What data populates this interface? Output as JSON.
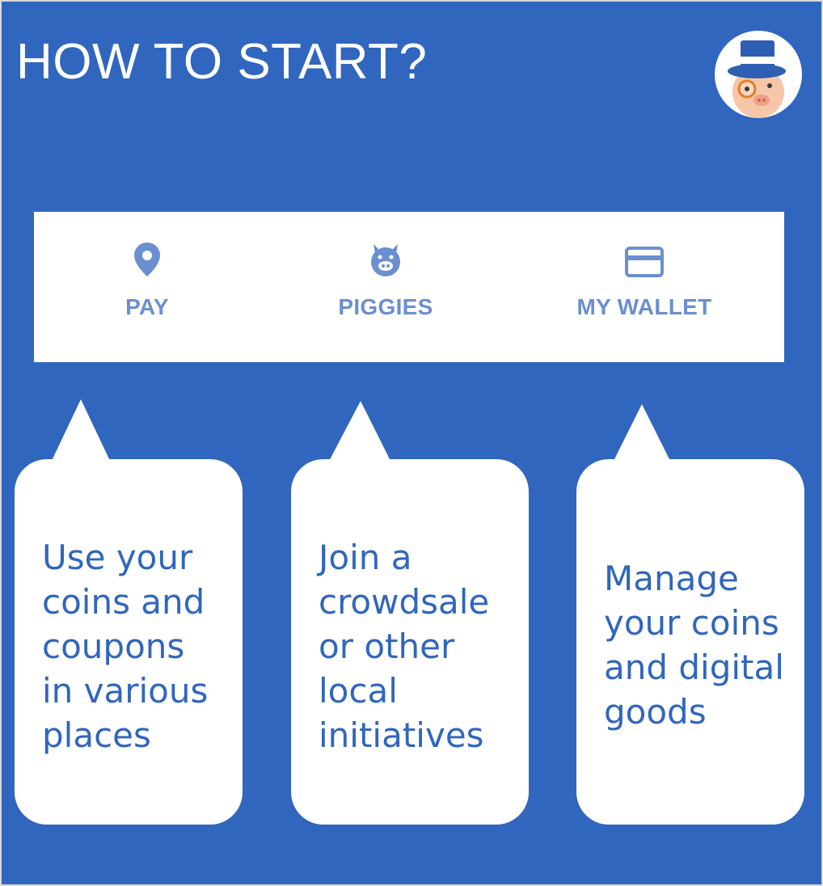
{
  "header": {
    "title": "HOW TO START?"
  },
  "avatar": {
    "icon": "pig-with-top-hat-icon"
  },
  "nav": {
    "items": [
      {
        "label": "PAY",
        "icon": "location-pin-icon"
      },
      {
        "label": "PIGGIES",
        "icon": "pig-face-icon"
      },
      {
        "label": "MY WALLET",
        "icon": "credit-card-icon"
      }
    ]
  },
  "bubbles": [
    {
      "text": "Use your\ncoins and\ncoupons\nin various\nplaces"
    },
    {
      "text": "Join a\ncrowdsale\nor other\nlocal\ninitiatives"
    },
    {
      "text": "Manage\nyour coins\nand digital\ngoods"
    }
  ],
  "colors": {
    "background": "#3066bd",
    "nav_label": "#6b8fd0",
    "bubble_text": "#3066bd"
  }
}
